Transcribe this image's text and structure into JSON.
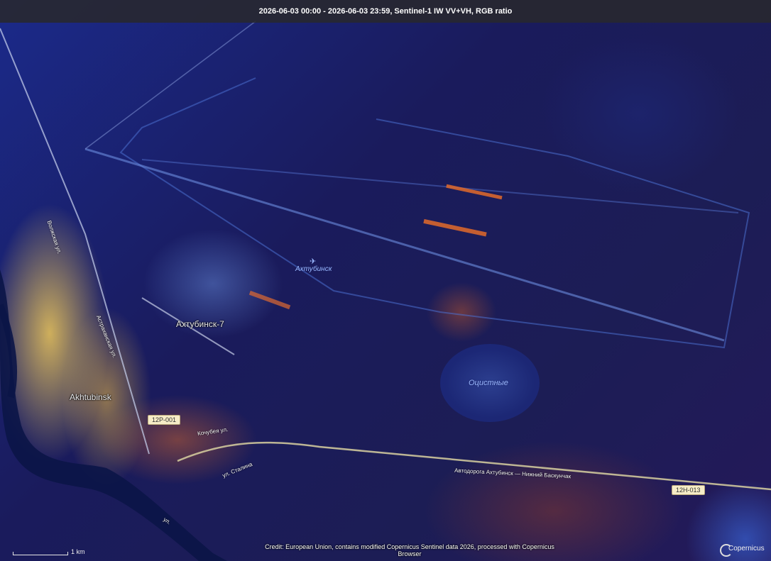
{
  "header": {
    "title": "2026-06-03 00:00 - 2026-06-03 23:59, Sentinel-1 IW VV+VH, RGB ratio"
  },
  "map": {
    "place_labels": {
      "akhtubinsk": "Akhtubinsk",
      "akhtubinsk7": "Ахтубинск-7",
      "airfield": "Ахтубинск",
      "lake": "Оцистные"
    },
    "road_labels": {
      "vertical_1": "Волжская ул.",
      "vertical_2": "Астраханская ул.",
      "street_1": "Кочубея ул.",
      "street_2": "ул. Сталина",
      "highway": "Автодорога Ахтубинск — Нижний Баскунчак",
      "river_edge": "ул."
    },
    "shields": {
      "shield_1": "12Р-001",
      "shield_2": "12Н-013"
    },
    "icons": {
      "airport": "airport-icon",
      "river": "river-icon"
    }
  },
  "footer": {
    "scale_label": "1 km",
    "credit": "Credit: European Union, contains modified Copernicus Sentinel data 2026, processed with Copernicus Browser",
    "logo_text": "Copernicus"
  },
  "colors": {
    "header_bg": "#28282d",
    "radar_urban": "#eec85a",
    "radar_rural": "#1a1b5c",
    "radar_bare": "#c85a28",
    "shield_bg": "#f6ecc7"
  }
}
